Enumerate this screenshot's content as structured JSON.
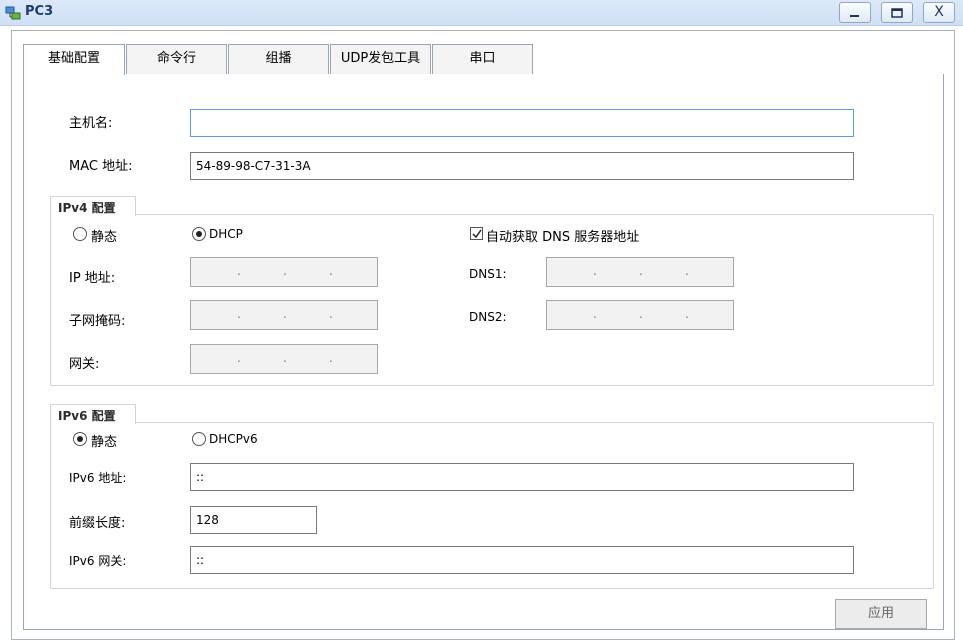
{
  "window": {
    "title": "PC3",
    "minimize_label": "_",
    "close_label": "X"
  },
  "tabs": [
    {
      "label": "基础配置",
      "active": true
    },
    {
      "label": "命令行",
      "active": false
    },
    {
      "label": "组播",
      "active": false
    },
    {
      "label": "UDP发包工具",
      "active": false
    },
    {
      "label": "串口",
      "active": false
    }
  ],
  "basic": {
    "hostname_label": "主机名:",
    "hostname_value": "",
    "mac_label": "MAC 地址:",
    "mac_value": "54-89-98-C7-31-3A"
  },
  "ipv4": {
    "title": "IPv4 配置",
    "static_label": "静态",
    "dhcp_label": "DHCP",
    "selected_mode": "DHCP",
    "auto_dns_label": "自动获取 DNS 服务器地址",
    "auto_dns_checked": true,
    "ip_label": "IP 地址:",
    "mask_label": "子网掩码:",
    "gateway_label": "网关:",
    "dns1_label": "DNS1:",
    "dns2_label": "DNS2:",
    "dot": "."
  },
  "ipv6": {
    "title": "IPv6 配置",
    "static_label": "静态",
    "dhcpv6_label": "DHCPv6",
    "selected_mode": "静态",
    "address_label": "IPv6 地址:",
    "address_value": "::",
    "prefix_label": "前缀长度:",
    "prefix_value": "128",
    "gateway_label": "IPv6 网关:",
    "gateway_value": "::"
  },
  "apply_label": "应用",
  "colors": {
    "titlebar": "#cfe0f4",
    "title_text": "#1b3d6b",
    "focus_border": "#5b9fd8"
  }
}
